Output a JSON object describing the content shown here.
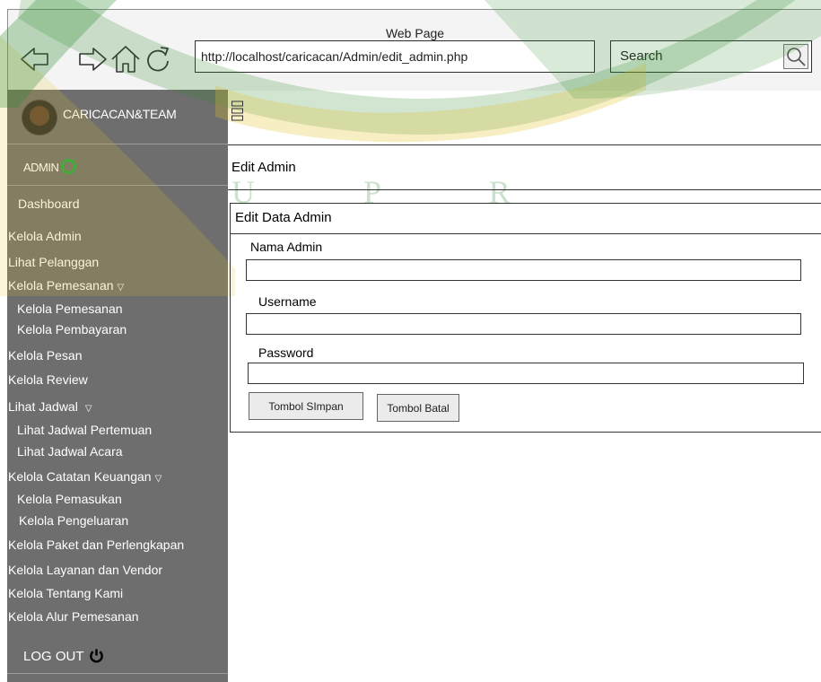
{
  "window": {
    "title": "Web Page",
    "url": "http://localhost/caricacan/Admin/edit_admin.php",
    "search_label": "Search",
    "nav_icons": [
      "back-arrow-icon",
      "forward-arrow-icon",
      "home-icon",
      "refresh-icon"
    ]
  },
  "sidebar": {
    "brand": "CARICACAN&TEAM",
    "role": "ADMIN",
    "items": [
      {
        "label": "Dashboard"
      },
      {
        "label": "Kelola Admin"
      },
      {
        "label": "Lihat Pelanggan"
      },
      {
        "label": "Kelola Pemesanan"
      },
      {
        "label": "Kelola Pemesanan"
      },
      {
        "label": "Kelola Pembayaran"
      },
      {
        "label": "Kelola Pesan"
      },
      {
        "label": "Kelola Review"
      },
      {
        "label": "Lihat Jadwal"
      },
      {
        "label": "Lihat Jadwal Pertemuan"
      },
      {
        "label": "Lihat Jadwal Acara"
      },
      {
        "label": "Kelola Catatan Keuangan"
      },
      {
        "label": "Kelola Pemasukan"
      },
      {
        "label": "Kelola Pengeluaran"
      },
      {
        "label": "Kelola Paket dan Perlengkapan"
      },
      {
        "label": "Kelola Layanan dan Vendor"
      },
      {
        "label": "Kelola Tentang Kami"
      },
      {
        "label": "Kelola Alur Pemesanan"
      }
    ],
    "logout": "LOG OUT"
  },
  "main": {
    "section_title": "Edit Admin",
    "card_title": "Edit Data Admin",
    "fields": [
      {
        "label": "Nama Admin",
        "value": ""
      },
      {
        "label": "Username",
        "value": ""
      },
      {
        "label": "Password",
        "value": ""
      }
    ],
    "save_button": "Tombol SImpan",
    "cancel_button": "Tombol Batal"
  },
  "watermark": {
    "letters": "U P R"
  },
  "colors": {
    "sidebar_bg": "#6e6e6e",
    "status_ring": "#1fa83b",
    "watermark_green": "#2f8a2f",
    "watermark_yellow": "#e3c32a"
  }
}
